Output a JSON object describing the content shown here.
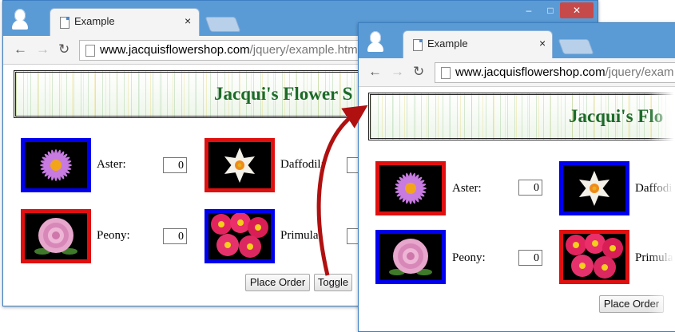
{
  "browser": {
    "tab_title": "Example",
    "tab_close": "×",
    "url_host": "www.jacquisflowershop.com",
    "url_path_left": "/jquery/example.htm",
    "url_path_right": "/jquery/exam",
    "back_icon": "←",
    "forward_icon": "→",
    "reload_icon": "↻",
    "minimize_icon": "–",
    "maximize_icon": "□",
    "close_icon": "✕"
  },
  "page": {
    "title_left": "Jacqui's Flower S",
    "title_right": "Jacqui's Flo"
  },
  "flowers_left": {
    "aster": {
      "label": "Aster:",
      "value": "0"
    },
    "daffodil": {
      "label": "Daffodil:",
      "value": ""
    },
    "peony": {
      "label": "Peony:",
      "value": "0"
    },
    "primula": {
      "label": "Primula:",
      "value": ""
    }
  },
  "flowers_right": {
    "aster": {
      "label": "Aster:",
      "value": "0"
    },
    "daffodil": {
      "label": "Daffodi",
      "value": ""
    },
    "peony": {
      "label": "Peony:",
      "value": "0"
    },
    "primula": {
      "label": "Primula",
      "value": ""
    }
  },
  "buttons": {
    "place_order": "Place Order",
    "toggle": "Toggle"
  },
  "colors": {
    "window_frame": "#5b9bd5",
    "heading": "#1c6a28",
    "arrow": "#b01010",
    "border_blue": "#0000ee",
    "border_red": "#e01010"
  }
}
